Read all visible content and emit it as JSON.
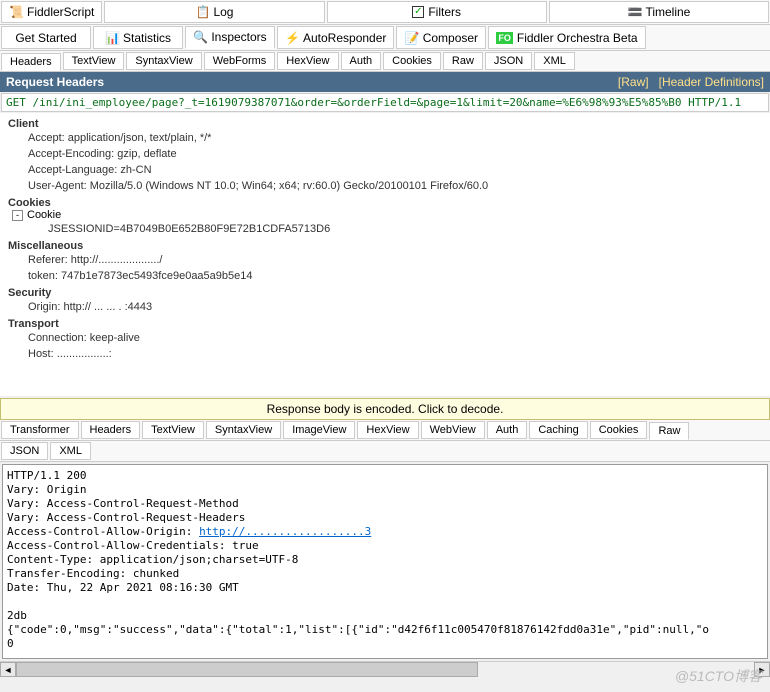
{
  "topTabs": [
    {
      "label": "FiddlerScript",
      "icon": "js"
    },
    {
      "label": "Log",
      "icon": "log"
    },
    {
      "label": "Filters",
      "icon": "check"
    },
    {
      "label": "Timeline",
      "icon": "timeline"
    },
    {
      "label": "Get Started",
      "icon": ""
    },
    {
      "label": "Statistics",
      "icon": "stats"
    },
    {
      "label": "Inspectors",
      "icon": "inspect",
      "selected": true
    },
    {
      "label": "AutoResponder",
      "icon": "auto"
    },
    {
      "label": "Composer",
      "icon": "compose"
    },
    {
      "label": "Fiddler Orchestra Beta",
      "icon": "fo"
    }
  ],
  "reqTabs": [
    "Headers",
    "TextView",
    "SyntaxView",
    "WebForms",
    "HexView",
    "Auth",
    "Cookies",
    "Raw",
    "JSON",
    "XML"
  ],
  "reqTabSelected": "Headers",
  "headerBar": {
    "title": "Request Headers",
    "raw": "[Raw]",
    "defs": "[Header Definitions]"
  },
  "requestLine": "GET /ini/ini_employee/page?_t=1619079387071&order=&orderField=&page=1&limit=20&name=%E6%98%93%E5%85%B0 HTTP/1.1",
  "sections": {
    "Client": [
      "Accept: application/json, text/plain, */*",
      "Accept-Encoding: gzip, deflate",
      "Accept-Language: zh-CN",
      "User-Agent: Mozilla/5.0 (Windows NT 10.0; Win64; x64; rv:60.0) Gecko/20100101 Firefox/60.0"
    ],
    "Cookies": {
      "sub": "Cookie",
      "items": [
        "JSESSIONID=4B7049B0E652B80F9E72B1CDFA5713D6"
      ]
    },
    "Miscellaneous": [
      "Referer: http://..................../",
      "token: 747b1e7873ec5493fce9e0aa5a9b5e14"
    ],
    "Security": [
      "Origin: http://  ... ...  .  :4443"
    ],
    "Transport": [
      "Connection: keep-alive",
      "Host: .................:"
    ]
  },
  "respBar": "Response body is encoded. Click to decode.",
  "respTabsRow1": [
    "Transformer",
    "Headers",
    "TextView",
    "SyntaxView",
    "ImageView",
    "HexView",
    "WebView",
    "Auth",
    "Caching",
    "Cookies",
    "Raw"
  ],
  "respTabsRow2": [
    "JSON",
    "XML"
  ],
  "respTabSelected": "Raw",
  "rawResponse": "HTTP/1.1 200\nVary: Origin\nVary: Access-Control-Request-Method\nVary: Access-Control-Request-Headers\nAccess-Control-Allow-Origin: <a>http://..................3</a>\nAccess-Control-Allow-Credentials: true\nContent-Type: application/json;charset=UTF-8\nTransfer-Encoding: chunked\nDate: Thu, 22 Apr 2021 08:16:30 GMT\n\n2db\n{\"code\":0,\"msg\":\"success\",\"data\":{\"total\":1,\"list\":[{\"id\":\"d42f6f11c005470f81876142fdd0a31e\",\"pid\":null,\"o\n0",
  "watermark": "@51CTO博客"
}
